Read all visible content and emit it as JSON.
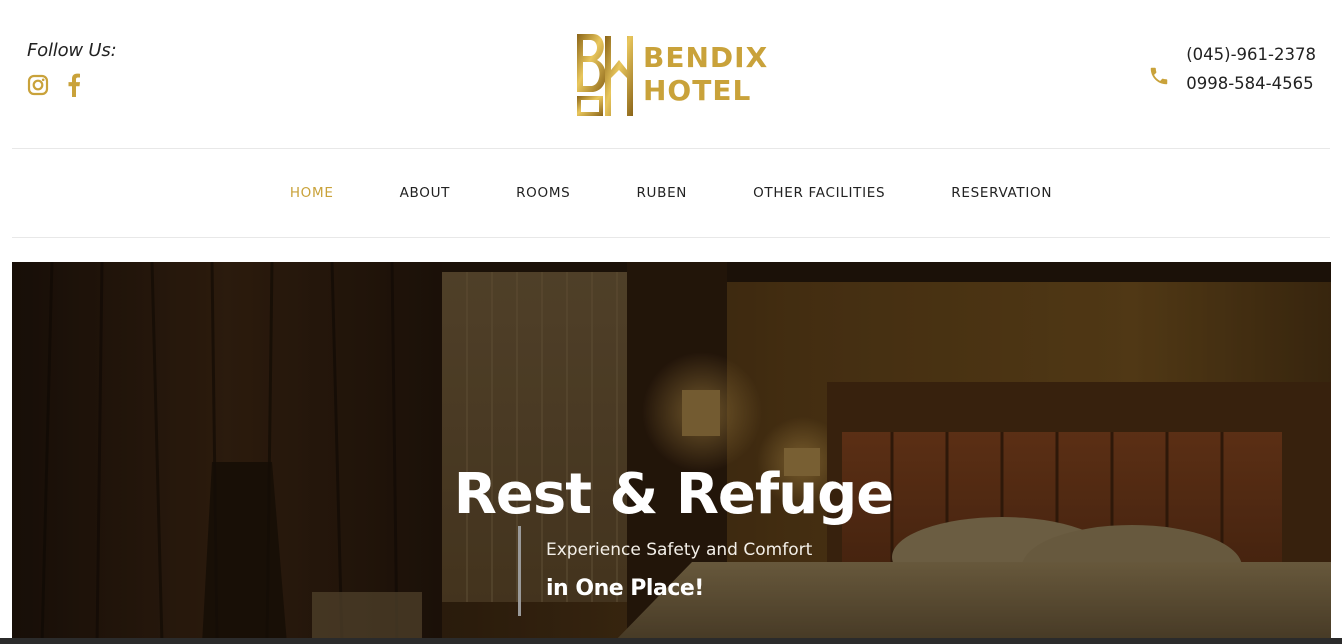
{
  "header": {
    "follow_label": "Follow Us:",
    "socials": [
      {
        "name": "instagram-icon",
        "label": "Instagram"
      },
      {
        "name": "facebook-icon",
        "label": "Facebook"
      }
    ],
    "logo": {
      "line1": "BENDIX",
      "line2": "HOTEL"
    },
    "contact": {
      "icon": "phone-icon",
      "phone1": "(045)-961-2378",
      "phone2": "0998-584-4565"
    }
  },
  "nav": {
    "items": [
      {
        "label": "HOME",
        "active": true
      },
      {
        "label": "ABOUT",
        "active": false
      },
      {
        "label": "ROOMS",
        "active": false
      },
      {
        "label": "RUBEN",
        "active": false
      },
      {
        "label": "OTHER FACILITIES",
        "active": false
      },
      {
        "label": "RESERVATION",
        "active": false
      }
    ]
  },
  "hero": {
    "title": "Rest & Refuge",
    "subtitle": "Experience Safety and Comfort",
    "tagline": "in One Place!"
  },
  "colors": {
    "accent": "#c9a23a",
    "text": "#222222",
    "hero_text": "#ffffff"
  }
}
